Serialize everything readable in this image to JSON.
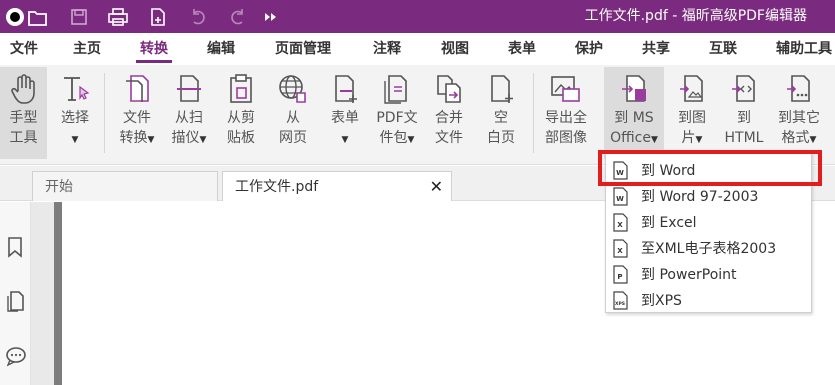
{
  "window": {
    "title": "工作文件.pdf - 福昕高级PDF编辑器"
  },
  "menu": {
    "items": [
      "文件",
      "主页",
      "转换",
      "编辑",
      "页面管理",
      "注释",
      "视图",
      "表单",
      "保护",
      "共享",
      "互联",
      "辅助工具"
    ],
    "active": "转换"
  },
  "ribbon": {
    "hand": {
      "line1": "手型",
      "line2": "工具"
    },
    "select": {
      "line1": "选择",
      "line2": ""
    },
    "file_convert": {
      "line1": "文件",
      "line2": "转换"
    },
    "from_scan": {
      "line1": "从扫",
      "line2": "描仪"
    },
    "from_clipboard": {
      "line1": "从剪",
      "line2": "贴板"
    },
    "from_webpage": {
      "line1": "从",
      "line2": "网页"
    },
    "form": {
      "line1": "表单",
      "line2": ""
    },
    "pdf_package": {
      "line1": "PDF文",
      "line2": "件包"
    },
    "merge": {
      "line1": "合并",
      "line2": "文件"
    },
    "blank_page": {
      "line1": "空",
      "line2": "白页"
    },
    "export_images": {
      "line1": "导出全",
      "line2": "部图像"
    },
    "to_ms_office": {
      "line1": "到 MS",
      "line2": "Office"
    },
    "to_image": {
      "line1": "到图",
      "line2": "片"
    },
    "to_html": {
      "line1": "到",
      "line2": "HTML"
    },
    "to_other": {
      "line1": "到其它",
      "line2": "格式"
    }
  },
  "tabs": {
    "start": "开始",
    "current": "工作文件.pdf"
  },
  "dropdown": {
    "items": [
      {
        "label": "到 Word",
        "icon": "word-doc-icon",
        "icon_letter": "W"
      },
      {
        "label": "到 Word 97-2003",
        "icon": "word-doc-icon",
        "icon_letter": "W"
      },
      {
        "label": "到 Excel",
        "icon": "excel-doc-icon",
        "icon_letter": "X"
      },
      {
        "label": "至XML电子表格2003",
        "icon": "xml-doc-icon",
        "icon_letter": "X"
      },
      {
        "label": "到 PowerPoint",
        "icon": "powerpoint-doc-icon",
        "icon_letter": "P"
      },
      {
        "label": "到XPS",
        "icon": "xps-doc-icon",
        "icon_letter": "XPS"
      }
    ],
    "highlighted": "到 Word"
  },
  "colors": {
    "brand": "#7b2b7f",
    "highlight": "#e21d1d"
  }
}
